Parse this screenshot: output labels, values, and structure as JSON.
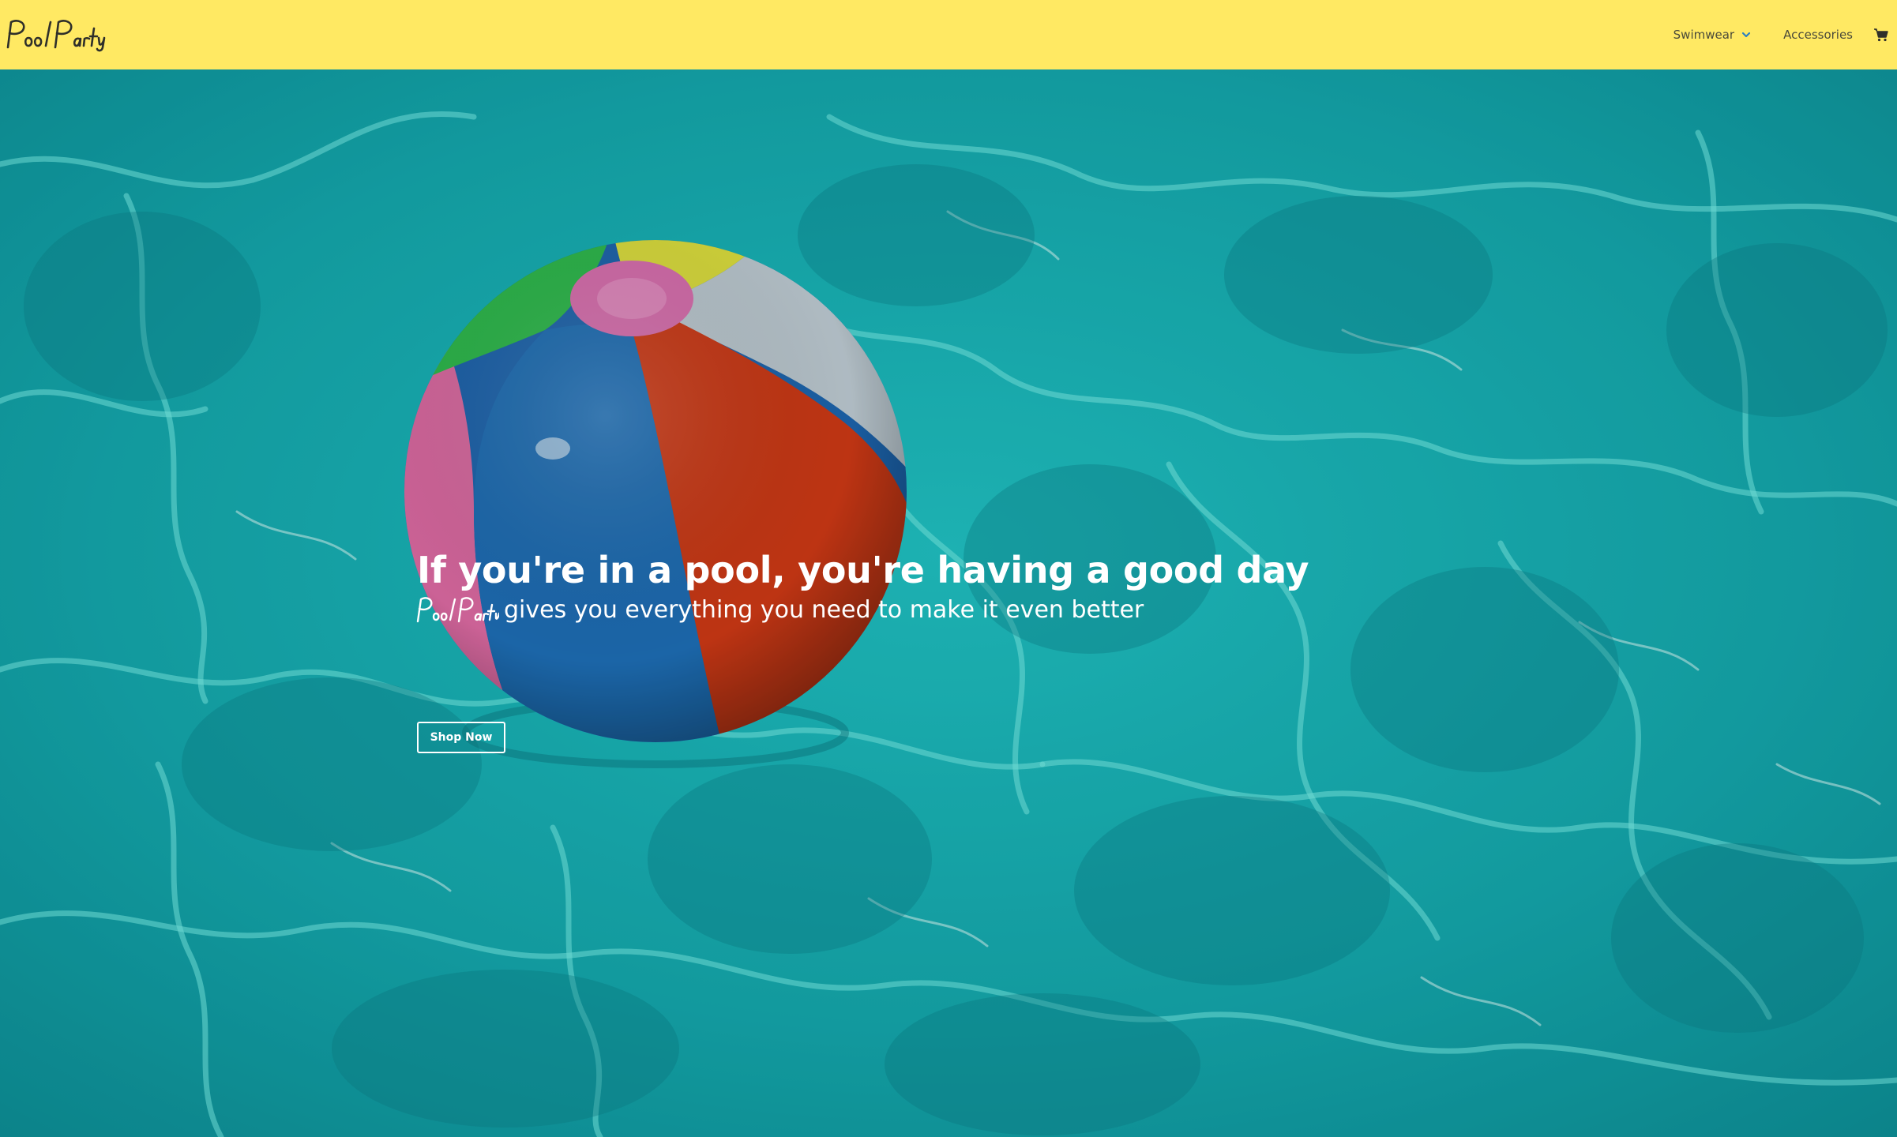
{
  "header": {
    "brand": "Pool Party",
    "nav": {
      "swimwear_label": "Swimwear",
      "accessories_label": "Accessories"
    },
    "icons": [
      "chevron-down-icon",
      "shopping-cart-icon"
    ],
    "background_color": "#ffe963"
  },
  "hero": {
    "headline": "If you're in a pool, you're having a good day",
    "subline_brand": "Pool Party",
    "subline_text": "gives you everything you need to make it even better",
    "cta_label": "Shop Now",
    "image": "beach-ball-floating-in-pool"
  },
  "colors": {
    "water": "#17b3b6",
    "text_on_hero": "#ffffff",
    "nav_text": "#4a4a3a"
  }
}
